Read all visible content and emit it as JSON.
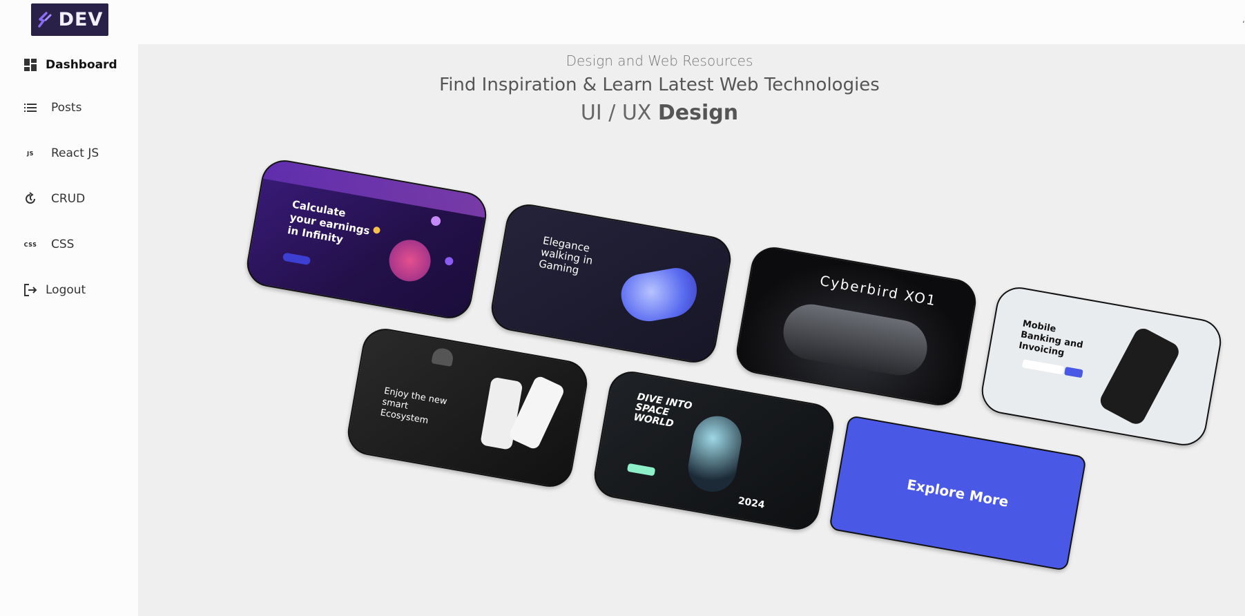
{
  "header": {
    "logo_text": "DEV"
  },
  "sidebar": {
    "items": [
      {
        "label": "Dashboard",
        "icon": "dashboard-icon",
        "active": true
      },
      {
        "label": "Posts",
        "icon": "list-icon"
      },
      {
        "label": "React JS",
        "icon": "js-icon",
        "icon_text": "JS"
      },
      {
        "label": "CRUD",
        "icon": "refresh-icon"
      },
      {
        "label": "CSS",
        "icon": "css-icon",
        "icon_text": "CSS"
      },
      {
        "label": "Logout",
        "icon": "logout-icon"
      }
    ]
  },
  "main": {
    "eyebrow": "Design and Web Resources",
    "headline": "Find Inspiration & Learn Latest Web Technologies",
    "subhead_prefix": "UI / UX ",
    "subhead_bold": "Design"
  },
  "cards": [
    {
      "text": "Calculate your earnings in Infinity"
    },
    {
      "text": "Elegance walking in Gaming"
    },
    {
      "text": "Cyberbird XO1"
    },
    {
      "text": "Mobile Banking and Invoicing"
    },
    {
      "text": "Enjoy the new smart Ecosystem"
    },
    {
      "text": "DIVE INTO SPACE WORLD",
      "year": "2024"
    },
    {
      "text": "Explore More"
    }
  ],
  "colors": {
    "logo_bg": "#2a2148",
    "accent": "#4a58e6",
    "main_bg": "#efefef"
  }
}
